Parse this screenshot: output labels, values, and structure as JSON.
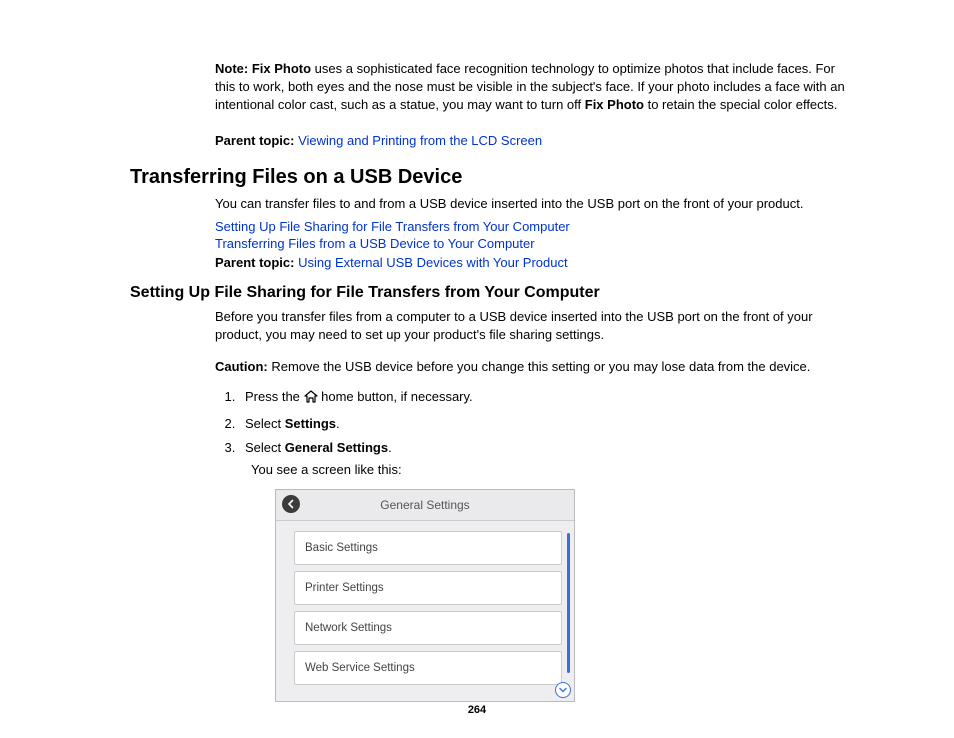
{
  "note": {
    "label": "Note:",
    "feature": "Fix Photo",
    "text_pre": " uses a sophisticated face recognition technology to optimize photos that include faces. For this to work, both eyes and the nose must be visible in the subject's face. If your photo includes a face with an intentional color cast, such as a statue, you may want to turn off ",
    "text_post": " to retain the special color effects."
  },
  "parent1": {
    "label": "Parent topic:",
    "link": "Viewing and Printing from the LCD Screen"
  },
  "h1": "Transferring Files on a USB Device",
  "intro1": "You can transfer files to and from a USB device inserted into the USB port on the front of your product.",
  "links": [
    "Setting Up File Sharing for File Transfers from Your Computer",
    "Transferring Files from a USB Device to Your Computer"
  ],
  "parent2": {
    "label": "Parent topic:",
    "link": "Using External USB Devices with Your Product"
  },
  "h2": "Setting Up File Sharing for File Transfers from Your Computer",
  "intro2": "Before you transfer files from a computer to a USB device inserted into the USB port on the front of your product, you may need to set up your product's file sharing settings.",
  "caution": {
    "label": "Caution:",
    "text": " Remove the USB device before you change this setting or you may lose data from the device."
  },
  "steps": {
    "s1_pre": "Press the ",
    "s1_post": " home button, if necessary.",
    "s2_pre": "Select ",
    "s2_bold": "Settings",
    "s2_post": ".",
    "s3_pre": "Select ",
    "s3_bold": "General Settings",
    "s3_post": ".",
    "s3_sub": "You see a screen like this:"
  },
  "lcd": {
    "title": "General Settings",
    "items": [
      "Basic Settings",
      "Printer Settings",
      "Network Settings",
      "Web Service Settings"
    ]
  },
  "page_number": "264"
}
